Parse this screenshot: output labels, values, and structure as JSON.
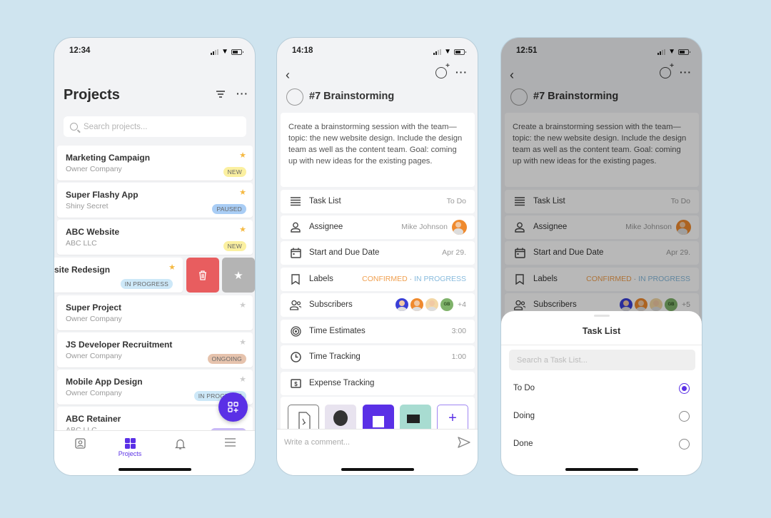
{
  "colors": {
    "accent": "#5a30e6",
    "background": "#cfe4ef",
    "delete": "#e85d5f",
    "confirmed": "#f0a050",
    "in_progress": "#88bbdd"
  },
  "screen1": {
    "time": "12:34",
    "title": "Projects",
    "search_placeholder": "Search projects...",
    "projects": [
      {
        "name": "Marketing Campaign",
        "owner": "Owner Company",
        "starred": true,
        "badge": "NEW"
      },
      {
        "name": "Super Flashy App",
        "owner": "Shiny Secret",
        "starred": true,
        "badge": "PAUSED"
      },
      {
        "name": "ABC Website",
        "owner": "ABC LLC",
        "starred": true,
        "badge": "NEW"
      },
      {
        "name": "site Redesign",
        "owner": "",
        "starred": true,
        "badge": "IN PROGRESS"
      },
      {
        "name": "Super Project",
        "owner": "Owner Company",
        "starred": false,
        "badge": ""
      },
      {
        "name": "JS Developer Recruitment",
        "owner": "Owner Company",
        "starred": false,
        "badge": "ONGOING"
      },
      {
        "name": "Mobile App Design",
        "owner": "Owner Company",
        "starred": false,
        "badge": "IN PROGRESS"
      },
      {
        "name": "ABC Retainer",
        "owner": "ABC LLC",
        "starred": false,
        "badge": ""
      }
    ],
    "swipe_actions": {
      "delete": "trash-icon",
      "unstar": "unstar-icon"
    },
    "tabbar": [
      {
        "icon": "profile-icon",
        "label": ""
      },
      {
        "icon": "grid-icon",
        "label": "Projects",
        "active": true
      },
      {
        "icon": "bell-icon",
        "label": ""
      },
      {
        "icon": "menu-icon",
        "label": ""
      }
    ]
  },
  "screen2": {
    "time": "14:18",
    "task_title": "#7 Brainstorming",
    "description": "Create a brainstorming session with the team—topic: the new website design. Include the design team as well as the content team. Goal: coming up with new ideas for the existing pages.",
    "rows": {
      "task_list": {
        "label": "Task List",
        "value": "To Do"
      },
      "assignee": {
        "label": "Assignee",
        "value": "Mike Johnson"
      },
      "dates": {
        "label": "Start and Due Date",
        "value": "Apr 29."
      },
      "labels": {
        "label": "Labels",
        "confirmed": "CONFIRMED",
        "sep": "·",
        "in_progress": "IN PROGRESS"
      },
      "subscribers": {
        "label": "Subscribers",
        "initials": "GB",
        "extra": "+4"
      },
      "time_estimates": {
        "label": "Time Estimates",
        "value": "3:00"
      },
      "time_tracking": {
        "label": "Time Tracking",
        "value": "1:00"
      },
      "expense_tracking": {
        "label": "Expense Tracking",
        "value": ""
      }
    },
    "add_attachment": "+",
    "comment_placeholder": "Write a comment..."
  },
  "screen3": {
    "time": "12:51",
    "task_title": "#7 Brainstorming",
    "description": "Create a brainstorming session with the team—topic: the new website design. Include the design team as well as the content team. Goal: coming up with new ideas for the existing pages.",
    "rows": {
      "task_list": {
        "label": "Task List",
        "value": "To Do"
      },
      "assignee": {
        "label": "Assignee",
        "value": "Mike Johnson"
      },
      "dates": {
        "label": "Start and Due Date",
        "value": "Apr 29."
      },
      "labels": {
        "label": "Labels",
        "confirmed": "CONFIRMED",
        "sep": "·",
        "in_progress": "IN PROGRESS"
      },
      "subscribers": {
        "label": "Subscribers",
        "initials": "GB",
        "extra": "+5"
      }
    },
    "sheet": {
      "title": "Task List",
      "search_placeholder": "Search a Task List...",
      "options": [
        {
          "label": "To Do",
          "selected": true
        },
        {
          "label": "Doing",
          "selected": false
        },
        {
          "label": "Done",
          "selected": false
        }
      ]
    }
  }
}
